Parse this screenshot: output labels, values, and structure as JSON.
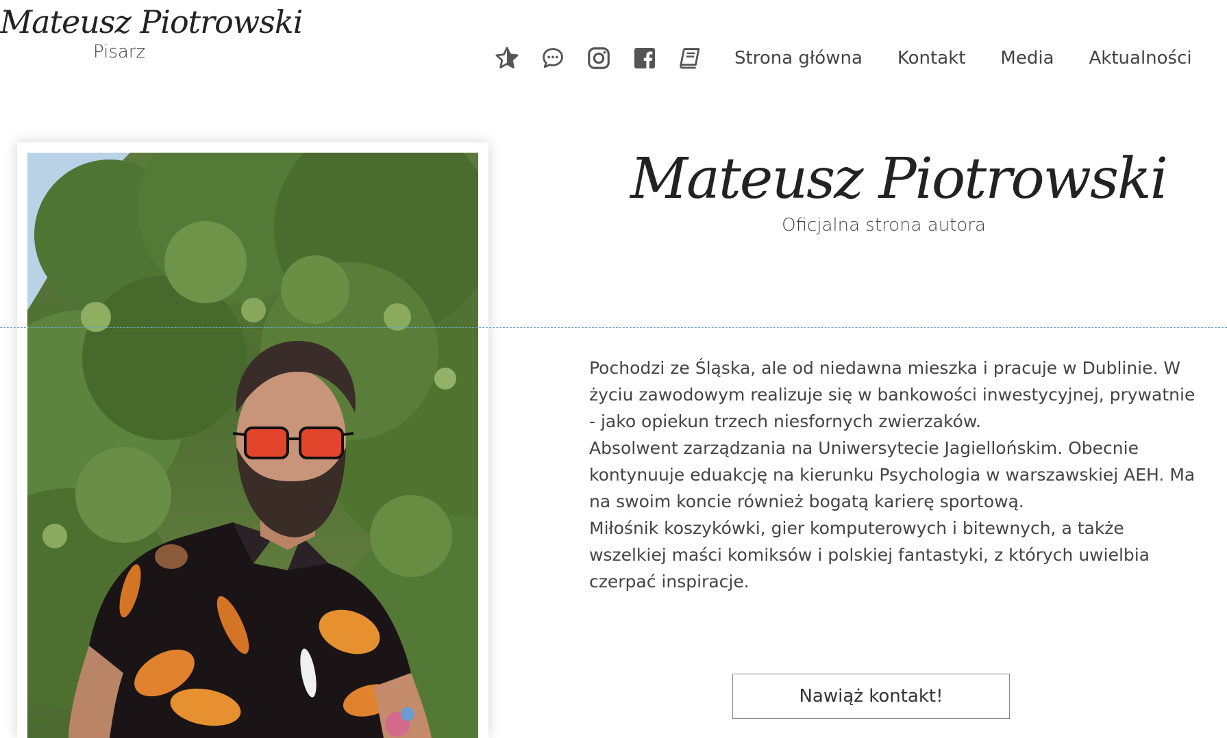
{
  "header": {
    "logo_name": "Mateusz Piotrowski",
    "logo_subtitle": "Pisarz",
    "icons": [
      "star-icon",
      "chat-icon",
      "instagram-icon",
      "facebook-icon",
      "book-icon"
    ],
    "nav_links": [
      "Strona główna",
      "Kontakt",
      "Media",
      "Aktualności"
    ]
  },
  "hero": {
    "title": "Mateusz Piotrowski",
    "subtitle": "Oficjalna strona autora"
  },
  "bio": {
    "paragraphs": [
      "Pochodzi ze Śląska, ale od niedawna mieszka i pracuje w Dublinie. W życiu zawodowym realizuje się w bankowości inwestycyjnej, prywatnie - jako opiekun trzech niesfornych zwierzaków.",
      "Absolwent zarządzania na Uniwersytecie Jagiellońskim. Obecnie kontynuuje eduakcję na kierunku Psychologia w warszawskiej AEH. Ma na swoim koncie również bogatą karierę sportową.",
      "Miłośnik koszykówki, gier komputerowych i bitewnych, a także wszelkiej maści komiksów i polskiej fantastyki, z których uwielbia czerpać inspiracje."
    ]
  },
  "cta": {
    "label": "Nawiąż kontakt!"
  },
  "colors": {
    "text": "#444444",
    "icon": "#555555",
    "guide": "#6aa6c8",
    "foliage": "#4e6d31"
  }
}
